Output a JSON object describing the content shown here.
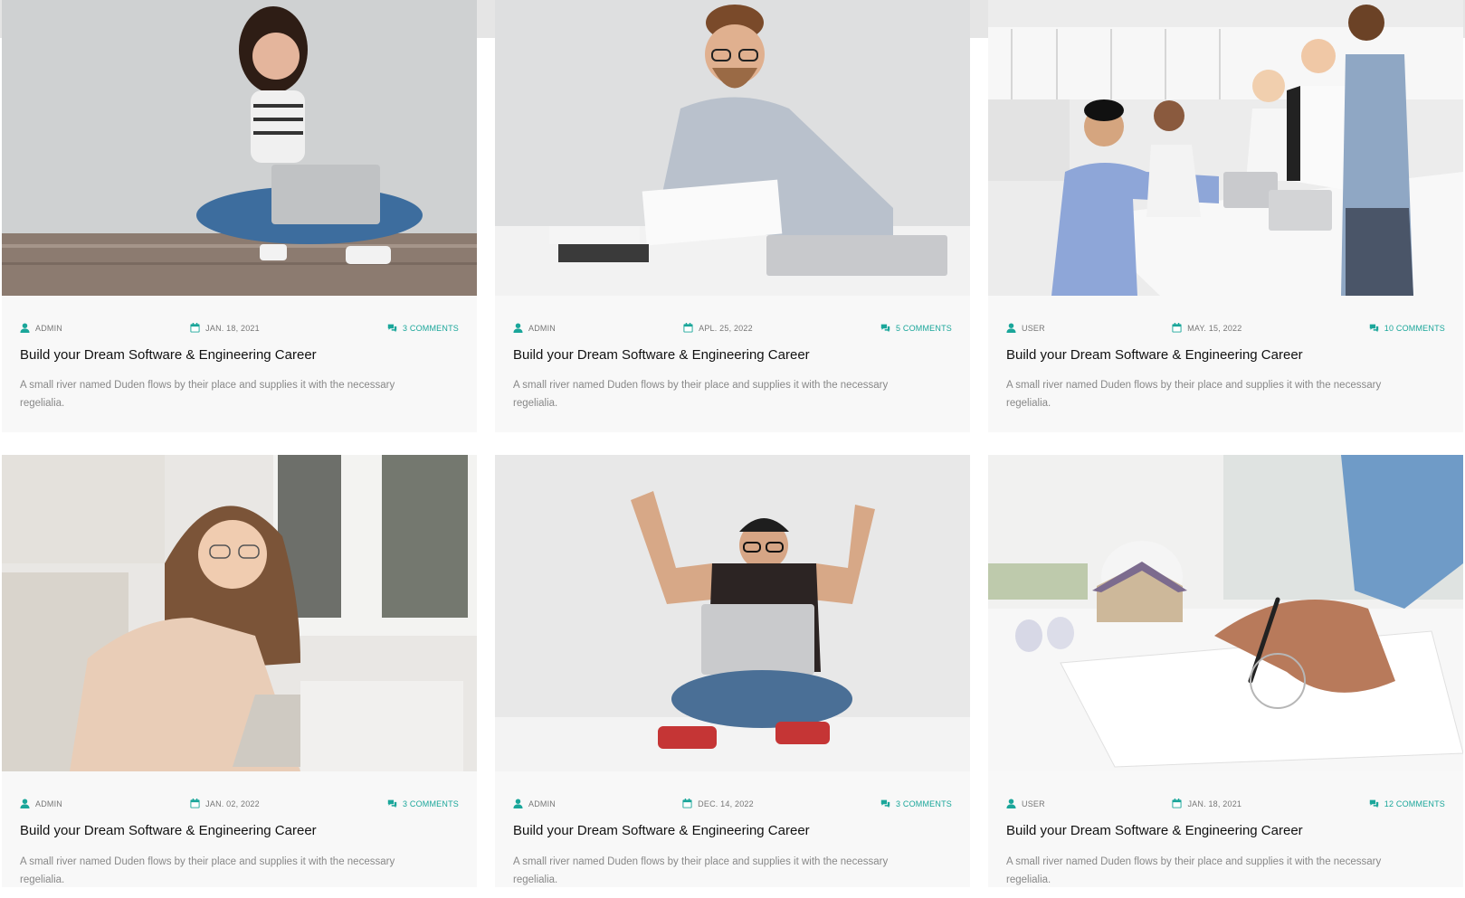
{
  "colors": {
    "accent": "#1aa69a",
    "card_bg": "#f8f8f8",
    "title": "#111111",
    "text": "#888888"
  },
  "posts": [
    {
      "author": "ADMIN",
      "date": "JAN. 18, 2021",
      "comments": "3 COMMENTS",
      "title": "Build your Dream Software & Engineering Career",
      "excerpt": "A small river named Duden flows by their place and supplies it with the necessary regelialia.",
      "image": "woman-laptop-floor"
    },
    {
      "author": "ADMIN",
      "date": "APL. 25, 2022",
      "comments": "5 COMMENTS",
      "title": "Build your Dream Software & Engineering Career",
      "excerpt": "A small river named Duden flows by their place and supplies it with the necessary regelialia.",
      "image": "man-glasses-desk"
    },
    {
      "author": "USER",
      "date": "MAY. 15, 2022",
      "comments": "10 COMMENTS",
      "title": "Build your Dream Software & Engineering Career",
      "excerpt": "A small river named Duden flows by their place and supplies it with the necessary regelialia.",
      "image": "team-thumbs-up"
    },
    {
      "author": "ADMIN",
      "date": "JAN. 02, 2022",
      "comments": "3 COMMENTS",
      "title": "Build your Dream Software & Engineering Career",
      "excerpt": "A small river named Duden flows by their place and supplies it with the necessary regelialia.",
      "image": "woman-glasses-laptop"
    },
    {
      "author": "ADMIN",
      "date": "DEC. 14, 2022",
      "comments": "3 COMMENTS",
      "title": "Build your Dream Software & Engineering Career",
      "excerpt": "A small river named Duden flows by their place and supplies it with the necessary regelialia.",
      "image": "man-celebrating-laptop"
    },
    {
      "author": "USER",
      "date": "JAN. 18, 2021",
      "comments": "12 COMMENTS",
      "title": "Build your Dream Software & Engineering Career",
      "excerpt": "A small river named Duden flows by their place and supplies it with the necessary regelialia.",
      "image": "architect-drawing-plans"
    }
  ]
}
